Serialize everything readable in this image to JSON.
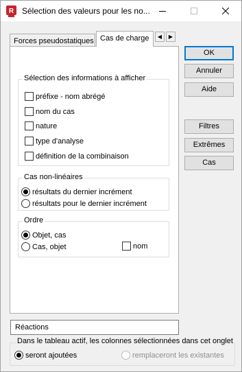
{
  "window": {
    "title": "Sélection des valeurs pour les no...",
    "app_icon_letter": "R"
  },
  "tabs": [
    {
      "label": "Forces pseudostatiques",
      "active": false
    },
    {
      "label": "Cas de charge",
      "active": true
    }
  ],
  "tab_scroll": {
    "left": "◀",
    "right": "▶"
  },
  "info_group": {
    "title": "Sélection des informations à afficher",
    "items": [
      {
        "label": "préfixe - nom abrégé",
        "checked": false
      },
      {
        "label": "nom du cas",
        "checked": false
      },
      {
        "label": "nature",
        "checked": false
      },
      {
        "label": "type d'analyse",
        "checked": false
      },
      {
        "label": "définition de la combinaison",
        "checked": false
      }
    ]
  },
  "nonlinear_group": {
    "title": "Cas non-linéaires",
    "options": [
      {
        "label": "résultats du dernier incrément",
        "selected": true
      },
      {
        "label": "résultats pour le dernier incrément",
        "selected": false
      }
    ]
  },
  "order_group": {
    "title": "Ordre",
    "options": [
      {
        "label": "Objet, cas",
        "selected": true
      },
      {
        "label": "Cas, objet",
        "selected": false
      }
    ],
    "nom_checkbox": {
      "label": "nom",
      "checked": false
    }
  },
  "buttons": {
    "ok": "OK",
    "cancel": "Annuler",
    "help": "Aide",
    "filters": "Filtres",
    "extremes": "Extrêmes",
    "cases": "Cas"
  },
  "reactions_field": {
    "value": "Réactions"
  },
  "columns_group": {
    "title": "Dans le tableau actif, les colonnes sélectionnées dans cet onglet",
    "options": [
      {
        "label": "seront ajoutées",
        "selected": true,
        "enabled": true
      },
      {
        "label": "remplaceront les existantes",
        "selected": false,
        "enabled": false
      }
    ]
  },
  "colors": {
    "app_icon": "#c4262e",
    "default_button_border": "#0078d7",
    "dialog_background": "#f0f0f0"
  }
}
